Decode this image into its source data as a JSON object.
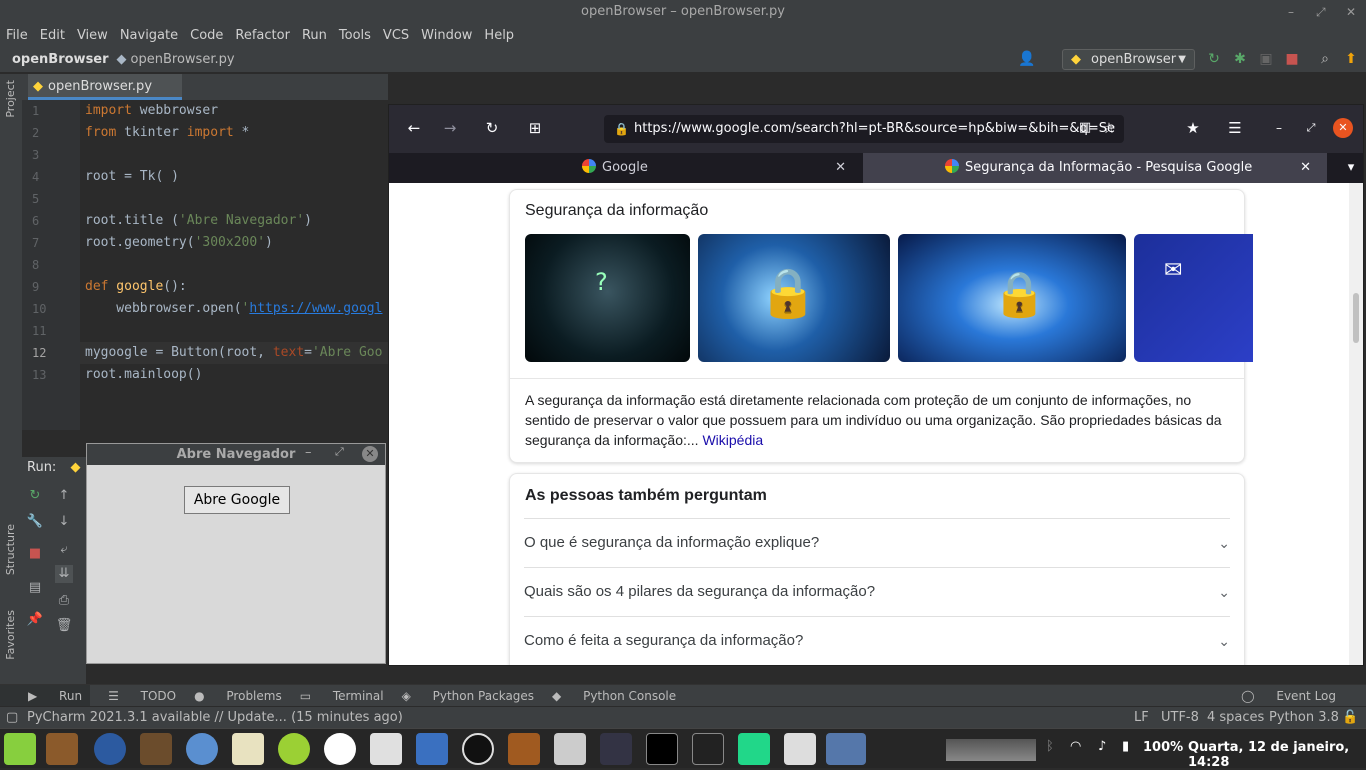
{
  "window": {
    "title": "openBrowser – openBrowser.py"
  },
  "menu": [
    "File",
    "Edit",
    "View",
    "Navigate",
    "Code",
    "Refactor",
    "Run",
    "Tools",
    "VCS",
    "Window",
    "Help"
  ],
  "nav": {
    "project": "openBrowser",
    "file": "openBrowser.py",
    "run_config": "openBrowser"
  },
  "editor_tab": "openBrowser.py",
  "side_labels": {
    "project": "Project",
    "structure": "Structure",
    "favorites": "Favorites"
  },
  "code": {
    "line_numbers": [
      "1",
      "2",
      "3",
      "4",
      "5",
      "6",
      "7",
      "8",
      "9",
      "10",
      "11",
      "12",
      "13"
    ],
    "l1a": "import",
    "l1b": " webbrowser",
    "l2a": "from",
    "l2b": " tkinter ",
    "l2c": "import",
    "l2d": " *",
    "l4": "root = Tk( )",
    "l6a": "root.title (",
    "l6b": "'Abre Navegador'",
    "l6c": ")",
    "l7a": "root.geometry(",
    "l7b": "'300x200'",
    "l7c": ")",
    "l9a": "def",
    "l9b": " google",
    "l9c": "():",
    "l10a": "    webbrowser.open(",
    "l10b": "'",
    "l10c": "https://www.googl",
    "l12a": "mygoogle = Button(root, ",
    "l12b": "text",
    "l12c": "=",
    "l12d": "'Abre Goo",
    "l13": "root.mainloop()"
  },
  "run": {
    "label": "Run:"
  },
  "tk_window": {
    "title": "Abre Navegador",
    "button": "Abre Google"
  },
  "browser": {
    "url": "https://www.google.com/search?hl=pt-BR&source=hp&biw=&bih=&q=Se",
    "tabs": [
      {
        "title": "Google"
      },
      {
        "title": "Segurança da Informação - Pesquisa Google"
      }
    ],
    "card_title": "Segurança da informação",
    "description": "A segurança da informação está diretamente relacionada com proteção de um conjunto de informações, no sentido de preservar o valor que possuem para um indivíduo ou uma organização. São propriedades básicas da segurança da informação:...",
    "wiki_link": "Wikipédia",
    "paa_title": "As pessoas também perguntam",
    "questions": [
      "O que é segurança da informação explique?",
      "Quais são os 4 pilares da segurança da informação?",
      "Como é feita a segurança da informação?"
    ]
  },
  "bottom_tools": {
    "run": "Run",
    "todo": "TODO",
    "problems": "Problems",
    "terminal": "Terminal",
    "packages": "Python Packages",
    "console": "Python Console",
    "event_log": "Event Log"
  },
  "status": {
    "message": "PyCharm 2021.3.1 available // Update... (15 minutes ago)",
    "line_sep": "LF",
    "encoding": "UTF-8",
    "indent": "4 spaces",
    "interpreter": "Python 3.8"
  },
  "taskbar": {
    "battery": "100%",
    "datetime": "Quarta, 12 de janeiro, 14:28"
  }
}
